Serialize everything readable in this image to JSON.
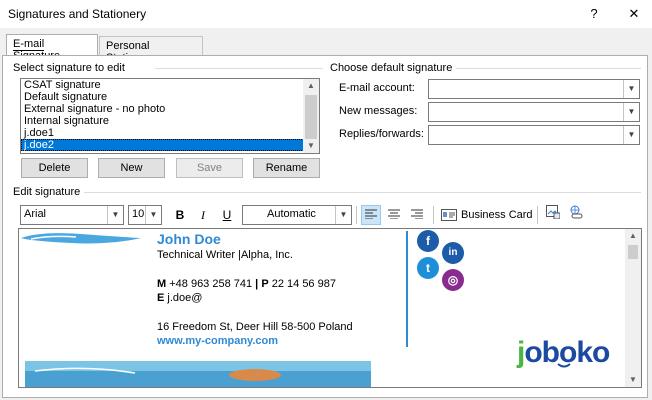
{
  "window": {
    "title": "Signatures and Stationery",
    "help_glyph": "?",
    "close_glyph": "✕"
  },
  "tabs": [
    {
      "label": "E-mail Signature",
      "active": true
    },
    {
      "label": "Personal Stationery",
      "active": false
    }
  ],
  "select_section": {
    "label": "Select signature to edit",
    "items": [
      "CSAT signature",
      "Default signature",
      "External signature - no photo",
      "Internal signature",
      "j.doe1",
      "j.doe2"
    ],
    "selected_index": 5
  },
  "list_buttons": {
    "delete": "Delete",
    "new": "New",
    "save": "Save",
    "rename": "Rename"
  },
  "default_section": {
    "label": "Choose default signature",
    "email_account_label": "E-mail account:",
    "email_account_value": "",
    "new_messages_label": "New messages:",
    "new_messages_value": "",
    "replies_label": "Replies/forwards:",
    "replies_value": ""
  },
  "edit_section": {
    "label": "Edit signature",
    "font": "Arial",
    "size": "10",
    "bold": "B",
    "italic": "I",
    "underline": "U",
    "color": "Automatic",
    "business_card": "Business Card"
  },
  "signature": {
    "name": "John Doe",
    "role": "Technical Writer |Alpha, Inc.",
    "phone_m_label": "M",
    "phone_m": "+48 963 258 741",
    "phone_sep": " | ",
    "phone_p_label": "P",
    "phone_p": "22 14 56 987",
    "email_label": "E",
    "email": "j.doe@",
    "address": "16 Freedom St, Deer Hill 58-500 Poland",
    "website": "www.my-company.com",
    "brand": "joboko",
    "brand_letters": [
      "j",
      "o",
      "b",
      "o",
      "k",
      "o"
    ]
  },
  "colors": {
    "accent": "#2f8ad6",
    "selection": "#0078d7",
    "facebook": "#1d5ca8",
    "linkedin": "#1d5ca8",
    "twitter": "#1d8fd8",
    "instagram": "#8a2c8f",
    "brand_blue": "#1b4aa0",
    "brand_green": "#49b646"
  },
  "icons": {
    "facebook": "f",
    "linkedin": "in",
    "twitter": "t",
    "instagram": "◎"
  }
}
